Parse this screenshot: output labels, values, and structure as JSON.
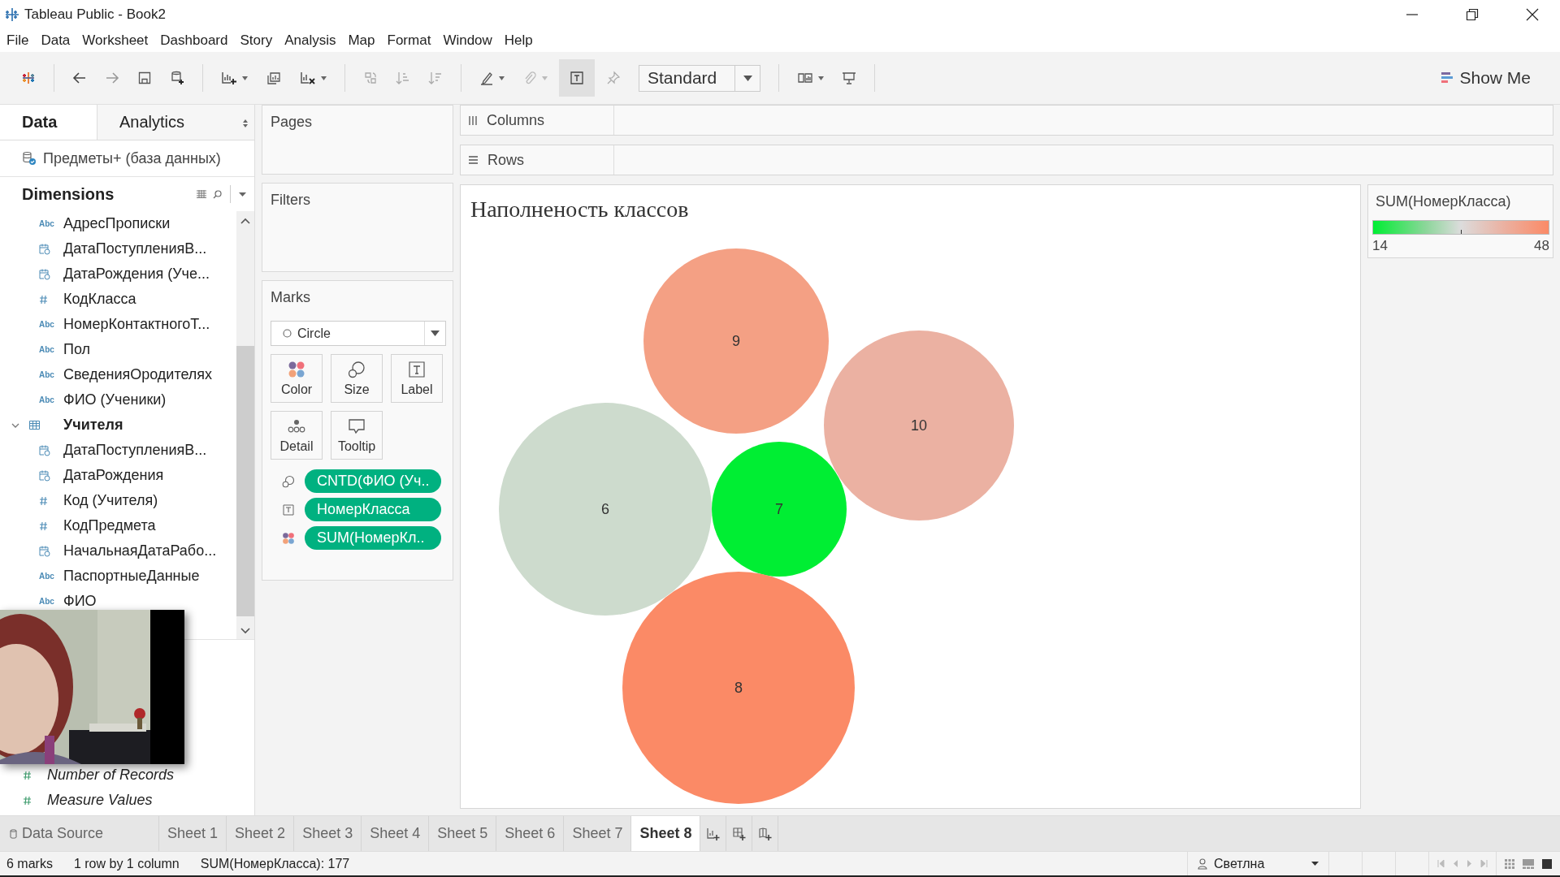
{
  "window": {
    "title": "Tableau Public - Book2"
  },
  "menu": [
    "File",
    "Data",
    "Worksheet",
    "Dashboard",
    "Story",
    "Analysis",
    "Map",
    "Format",
    "Window",
    "Help"
  ],
  "toolbar": {
    "mark_type_menu": "Standard",
    "show_me": "Show Me"
  },
  "data_pane": {
    "tabs": [
      {
        "label": "Data",
        "selected": true
      },
      {
        "label": "Analytics",
        "selected": false
      }
    ],
    "data_source": "Предметы+ (база данных)",
    "dimensions_heading": "Dimensions",
    "fields": [
      {
        "name": "АдресПрописки",
        "kind": "string",
        "type_glyph": "Abc"
      },
      {
        "name": "ДатаПоступленияВ...",
        "kind": "date"
      },
      {
        "name": "ДатаРождения (Уче...",
        "kind": "date"
      },
      {
        "name": "КодКласса",
        "kind": "number"
      },
      {
        "name": "НомерКонтактногоТ...",
        "kind": "string",
        "type_glyph": "Abc"
      },
      {
        "name": "Пол",
        "kind": "string",
        "type_glyph": "Abc"
      },
      {
        "name": "СведенияОродителях",
        "kind": "string",
        "type_glyph": "Abc"
      },
      {
        "name": "ФИО (Ученики)",
        "kind": "string",
        "type_glyph": "Abc"
      },
      {
        "name": "Учителя",
        "kind": "table",
        "expanded": true,
        "children": [
          {
            "name": "ДатаПоступленияВ...",
            "kind": "date"
          },
          {
            "name": "ДатаРождения",
            "kind": "date"
          },
          {
            "name": "Код (Учителя)",
            "kind": "number"
          },
          {
            "name": "КодПредмета",
            "kind": "number"
          },
          {
            "name": "НачальнаяДатаРабо...",
            "kind": "date"
          },
          {
            "name": "ПаспортныеДанные",
            "kind": "string",
            "type_glyph": "Abc"
          },
          {
            "name": "ФИО",
            "kind": "string",
            "type_glyph": "Abc"
          }
        ]
      }
    ],
    "measures": [
      {
        "name": "Number of Records",
        "kind": "number"
      },
      {
        "name": "Measure Values",
        "kind": "number"
      }
    ]
  },
  "shelves": {
    "pages": "Pages",
    "filters": "Filters",
    "columns": "Columns",
    "rows": "Rows"
  },
  "marks": {
    "title": "Marks",
    "mark_type": "Circle",
    "buttons": [
      {
        "label": "Color",
        "kind": "color"
      },
      {
        "label": "Size",
        "kind": "size"
      },
      {
        "label": "Label",
        "kind": "label"
      },
      {
        "label": "Detail",
        "kind": "detail"
      },
      {
        "label": "Tooltip",
        "kind": "tooltip"
      }
    ],
    "pills": [
      {
        "kind": "size",
        "label": "CNTD(ФИО (Уч.."
      },
      {
        "kind": "label",
        "label": "НомерКласса"
      },
      {
        "kind": "color",
        "label": "SUM(НомерКл.."
      }
    ]
  },
  "view": {
    "title": "Наполненость классов",
    "bubbles": [
      {
        "label": "9",
        "color": "#f4a084"
      },
      {
        "label": "10",
        "color": "#ebb1a2"
      },
      {
        "label": "6",
        "color": "#cddbcd"
      },
      {
        "label": "7",
        "color": "#00ee33"
      },
      {
        "label": "8",
        "color": "#fb8a66"
      }
    ]
  },
  "legend": {
    "title": "SUM(НомерКласса)",
    "min": "14",
    "max": "48"
  },
  "sheet_tabs": [
    {
      "label": "Data Source",
      "kind": "data-source",
      "selected": false
    },
    {
      "label": "Sheet 1",
      "kind": "sheet",
      "selected": false
    },
    {
      "label": "Sheet 2",
      "kind": "sheet",
      "selected": false
    },
    {
      "label": "Sheet 3",
      "kind": "sheet",
      "selected": false
    },
    {
      "label": "Sheet 4",
      "kind": "sheet",
      "selected": false
    },
    {
      "label": "Sheet 5",
      "kind": "sheet",
      "selected": false
    },
    {
      "label": "Sheet 6",
      "kind": "sheet",
      "selected": false
    },
    {
      "label": "Sheet 7",
      "kind": "sheet",
      "selected": false
    },
    {
      "label": "Sheet 8",
      "kind": "sheet",
      "selected": true
    }
  ],
  "status_bar": {
    "marks": "6 marks",
    "layout": "1 row by 1 column",
    "sum": "SUM(НомерКласса): 177",
    "user": "Светлна"
  }
}
